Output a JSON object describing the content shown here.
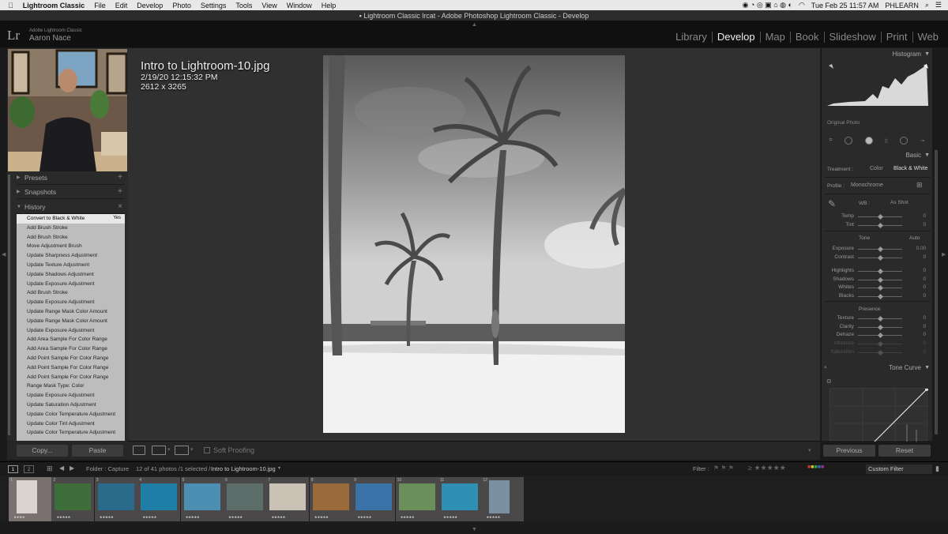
{
  "menubar": {
    "items": [
      "Lightroom Classic",
      "File",
      "Edit",
      "Develop",
      "Photo",
      "Settings",
      "Tools",
      "View",
      "Window",
      "Help"
    ],
    "clock": "Tue Feb 25  11:57 AM",
    "user": "PHLEARN"
  },
  "window": {
    "title": "Lightroom Classic lrcat - Adobe Photoshop Lightroom Classic - Develop"
  },
  "identity": {
    "logo": "Lr",
    "app": "Adobe Lightroom Classic",
    "name": "Aaron Nace"
  },
  "modules": [
    "Library",
    "Develop",
    "Map",
    "Book",
    "Slideshow",
    "Print",
    "Web"
  ],
  "left_panel": {
    "presets_label": "Presets",
    "snapshots_label": "Snapshots",
    "history_label": "History",
    "history_items": [
      "Convert to Black & White",
      "Add Brush Stroke",
      "Add Brush Stroke",
      "Move Adjustment Brush",
      "Update Sharpness Adjustment",
      "Update Texture Adjustment",
      "Update Shadows Adjustment",
      "Update Exposure Adjustment",
      "Add Brush Stroke",
      "Update Exposure Adjustment",
      "Update Range Mask Color Amount",
      "Update Range Mask Color Amount",
      "Update Exposure Adjustment",
      "Add Area Sample For Color Range",
      "Add Area Sample For Color Range",
      "Add Point Sample For Color Range",
      "Add Point Sample For Color Range",
      "Add Point Sample For Color Range",
      "Range Mask Type: Color",
      "Update Exposure Adjustment",
      "Update Saturation Adjustment",
      "Update Color Temperature Adjustment",
      "Update Color Tint Adjustment",
      "Update Color Temperature Adjustment"
    ],
    "history_selected_badge": "Yes",
    "copy_label": "Copy...",
    "paste_label": "Paste"
  },
  "photo": {
    "filename": "Intro to Lightroom-10.jpg",
    "datetime": "2/19/20 12:15:32 PM",
    "dimensions": "2612 x 3265"
  },
  "toolbar": {
    "soft_proofing": "Soft Proofing"
  },
  "right_panel": {
    "histogram_label": "Histogram",
    "original_photo": "Original Photo",
    "basic_label": "Basic",
    "treatment_label": "Treatment :",
    "treatment_color": "Color",
    "treatment_bw": "Black & White",
    "profile_label": "Profile :",
    "profile_value": "Monochrome",
    "wb_label": "WB :",
    "wb_value": "As Shot",
    "tone_label": "Tone",
    "auto_label": "Auto",
    "presence_label": "Presence",
    "sliders_wb": [
      {
        "label": "Temp",
        "value": "0",
        "pos": 0.5
      },
      {
        "label": "Tint",
        "value": "0",
        "pos": 0.5
      }
    ],
    "sliders_tone": [
      {
        "label": "Exposure",
        "value": "0.00",
        "pos": 0.5
      },
      {
        "label": "Contrast",
        "value": "0",
        "pos": 0.5
      }
    ],
    "sliders_tone2": [
      {
        "label": "Highlights",
        "value": "0",
        "pos": 0.5
      },
      {
        "label": "Shadows",
        "value": "0",
        "pos": 0.5
      },
      {
        "label": "Whites",
        "value": "0",
        "pos": 0.5
      },
      {
        "label": "Blacks",
        "value": "0",
        "pos": 0.5
      }
    ],
    "sliders_presence": [
      {
        "label": "Texture",
        "value": "0",
        "pos": 0.5
      },
      {
        "label": "Clarity",
        "value": "0",
        "pos": 0.5
      },
      {
        "label": "Dehaze",
        "value": "0",
        "pos": 0.5
      },
      {
        "label": "Vibrance",
        "value": "0",
        "pos": 0.5
      },
      {
        "label": "Saturation",
        "value": "0",
        "pos": 0.5
      }
    ],
    "tone_curve_label": "Tone Curve",
    "previous_label": "Previous",
    "reset_label": "Reset"
  },
  "filmstrip": {
    "folder": "Folder : Capture",
    "count": "12 of 41 photos /1 selected /",
    "current": "Intro to Lightroom-10.jpg",
    "filter_label": "Filter :",
    "custom_filter": "Custom Filter",
    "page1": "1",
    "page2": "2",
    "thumbs": [
      {
        "index": "1",
        "color": "#d9d4cf",
        "sel": true,
        "stars": "★★★★"
      },
      {
        "index": "2",
        "color": "#3d6e3a",
        "sel": false,
        "stars": "★★★★★"
      },
      {
        "index": "3",
        "color": "#2a6a8a",
        "sel": false,
        "stars": "★★★★★"
      },
      {
        "index": "4",
        "color": "#1e7ea5",
        "sel": false,
        "stars": "★★★★★"
      },
      {
        "index": "5",
        "color": "#4c8fb3",
        "sel": false,
        "stars": "★★★★★"
      },
      {
        "index": "6",
        "color": "#5d6e6a",
        "sel": false,
        "stars": "★★★★★"
      },
      {
        "index": "7",
        "color": "#c9c2b5",
        "sel": false,
        "stars": "★★★★★"
      },
      {
        "index": "8",
        "color": "#9a6a3a",
        "sel": false,
        "stars": "★★★★★"
      },
      {
        "index": "9",
        "color": "#3a73a8",
        "sel": false,
        "stars": "★★★★★"
      },
      {
        "index": "10",
        "color": "#6a8f5a",
        "sel": false,
        "stars": "★★★★★"
      },
      {
        "index": "11",
        "color": "#2f8fb5",
        "sel": false,
        "stars": "★★★★★"
      },
      {
        "index": "12",
        "color": "#7a8fa0",
        "sel": false,
        "stars": "★★★★★"
      }
    ]
  }
}
